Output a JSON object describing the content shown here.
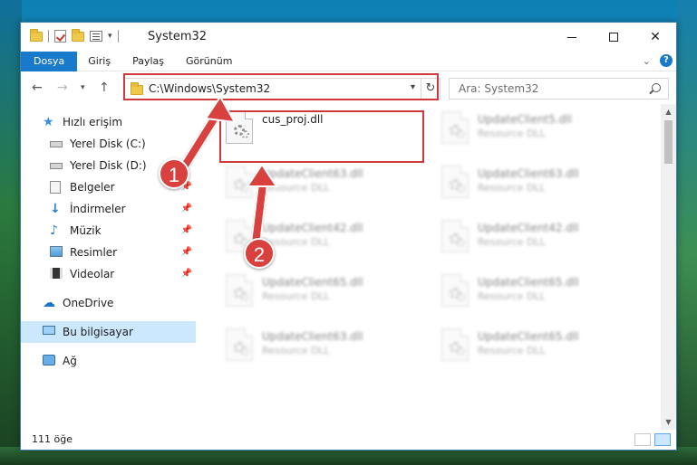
{
  "window": {
    "title": "System32"
  },
  "ribbon": {
    "tabs": [
      {
        "label": "Dosya"
      },
      {
        "label": "Giriş"
      },
      {
        "label": "Paylaş"
      },
      {
        "label": "Görünüm"
      }
    ]
  },
  "navbar": {
    "address": "C:\\Windows\\System32",
    "search_placeholder": "Ara: System32"
  },
  "sidebar": {
    "items": [
      {
        "label": "Hızlı erişim",
        "icon": "star-icon"
      },
      {
        "label": "Yerel Disk (C:)",
        "icon": "drive-icon"
      },
      {
        "label": "Yerel Disk (D:)",
        "icon": "drive-icon"
      },
      {
        "label": "Belgeler",
        "icon": "documents-icon"
      },
      {
        "label": "İndirmeler",
        "icon": "download-icon"
      },
      {
        "label": "Müzik",
        "icon": "music-icon"
      },
      {
        "label": "Resimler",
        "icon": "pictures-icon"
      },
      {
        "label": "Videolar",
        "icon": "videos-icon"
      },
      {
        "label": "OneDrive",
        "icon": "cloud-icon"
      },
      {
        "label": "Bu bilgisayar",
        "icon": "computer-icon"
      },
      {
        "label": "Ağ",
        "icon": "network-icon"
      }
    ]
  },
  "files": [
    {
      "name": "cus_proj.dll",
      "type": ""
    },
    {
      "name": "UpdateClient5.dll",
      "type": "Resource DLL"
    },
    {
      "name": "UpdateClient63.dll",
      "type": "Resource DLL"
    },
    {
      "name": "UpdateClient63.dll",
      "type": "Resource DLL"
    },
    {
      "name": "UpdateClient42.dll",
      "type": "Resource DLL"
    },
    {
      "name": "UpdateClient42.dll",
      "type": "Resource DLL"
    },
    {
      "name": "UpdateClient65.dll",
      "type": "Resource DLL"
    },
    {
      "name": "UpdateClient65.dll",
      "type": "Resource DLL"
    },
    {
      "name": "UpdateClient63.dll",
      "type": "Resource DLL"
    },
    {
      "name": "UpdateClient65.dll",
      "type": "Resource DLL"
    }
  ],
  "status": {
    "item_count": "111 öğe"
  },
  "annotations": {
    "step1": "1",
    "step2": "2"
  },
  "colors": {
    "accent": "#1979ca",
    "highlight": "#d0393c",
    "selected": "#cce8ff"
  }
}
